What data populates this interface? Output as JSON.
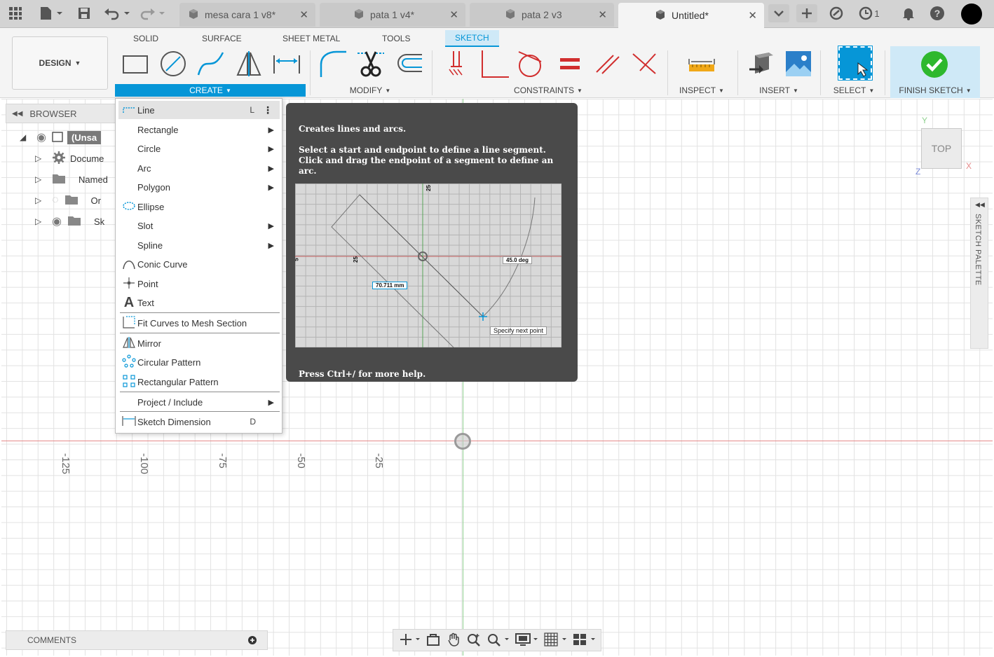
{
  "titlebar": {
    "tabs": [
      {
        "label": "mesa cara 1 v8*",
        "active": false
      },
      {
        "label": "pata 1 v4*",
        "active": false
      },
      {
        "label": "pata 2 v3",
        "active": false
      },
      {
        "label": "Untitled*",
        "active": true
      }
    ],
    "job_count": "1"
  },
  "toolbar": {
    "workspace": "DESIGN",
    "workspace_tabs": [
      "SOLID",
      "SURFACE",
      "SHEET METAL",
      "TOOLS",
      "SKETCH"
    ],
    "active_workspace_tab": "SKETCH",
    "groups": {
      "create": "CREATE",
      "modify": "MODIFY",
      "constraints": "CONSTRAINTS",
      "inspect": "INSPECT",
      "insert": "INSERT",
      "select": "SELECT",
      "finish": "FINISH SKETCH"
    }
  },
  "browser": {
    "title": "BROWSER",
    "root": "(Unsa",
    "items": [
      "Docume",
      "Named ",
      "Or",
      "Sk"
    ]
  },
  "menu": {
    "items": [
      {
        "label": "Line",
        "shortcut": "L"
      },
      {
        "label": "Rectangle"
      },
      {
        "label": "Circle"
      },
      {
        "label": "Arc"
      },
      {
        "label": "Polygon"
      },
      {
        "label": "Ellipse"
      },
      {
        "label": "Slot"
      },
      {
        "label": "Spline"
      },
      {
        "label": "Conic Curve"
      },
      {
        "label": "Point"
      },
      {
        "label": "Text"
      },
      {
        "label": "Fit Curves to Mesh Section"
      },
      {
        "label": "Mirror"
      },
      {
        "label": "Circular Pattern"
      },
      {
        "label": "Rectangular Pattern"
      },
      {
        "label": "Project / Include"
      },
      {
        "label": "Sketch Dimension",
        "shortcut": "D"
      }
    ]
  },
  "tooltip": {
    "title": "Creates lines and arcs.",
    "body": "Select a start and endpoint to define a line segment. Click and drag the endpoint of a segment to define an arc.",
    "footer": "Press Ctrl+/ for more help.",
    "image_labels": {
      "top_tick": "25",
      "mid_tick": "25",
      "left_tick": "5",
      "length": "70.711 mm",
      "angle": "45.0 deg",
      "prompt": "Specify next point"
    }
  },
  "canvas": {
    "ruler_ticks": [
      "-125",
      "-100",
      "-75",
      "-50",
      "-25"
    ]
  },
  "viewcube": {
    "face": "TOP",
    "x": "X",
    "y": "Y",
    "z": "Z"
  },
  "palette": {
    "title": "SKETCH PALETTE"
  },
  "comments": {
    "title": "COMMENTS"
  },
  "colors": {
    "accent": "#0696d7",
    "x_axis": "#e58a8a",
    "y_axis": "#8fd18f",
    "finish_check": "#2eb82e"
  }
}
